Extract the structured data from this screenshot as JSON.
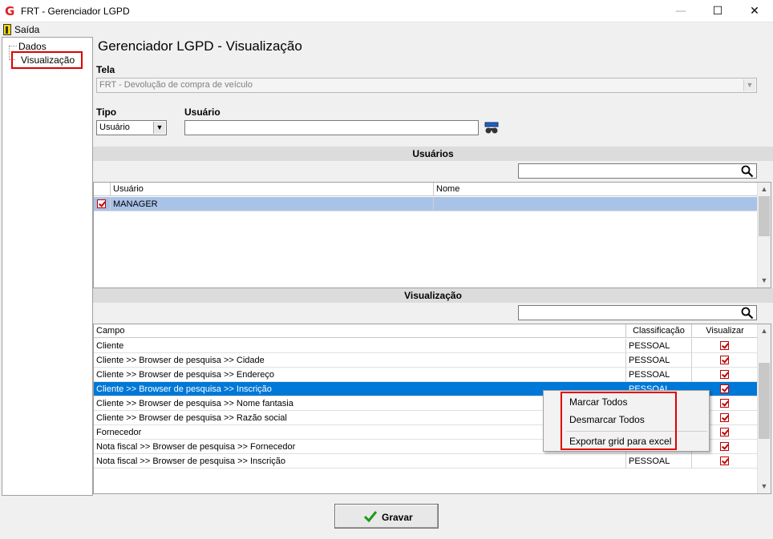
{
  "window": {
    "title": "FRT - Gerenciador LGPD",
    "app_icon": "G",
    "controls": {
      "minimize": "—",
      "maximize": "☐",
      "close": "✕"
    }
  },
  "menu": {
    "exit_label": "Saída"
  },
  "tree": {
    "items": [
      {
        "label": "Dados"
      },
      {
        "label": "Visualização",
        "selected": true
      }
    ]
  },
  "main": {
    "title": "Gerenciador LGPD - Visualização",
    "tela": {
      "label": "Tela",
      "value": "FRT - Devolução de compra de veículo"
    },
    "tipo": {
      "label": "Tipo",
      "value": "Usuário"
    },
    "usuario": {
      "label": "Usuário",
      "value": ""
    }
  },
  "usuarios_section": {
    "title": "Usuários",
    "columns": [
      "Usuário",
      "Nome"
    ],
    "rows": [
      {
        "usuario": "MANAGER",
        "nome": "",
        "checked": true
      }
    ]
  },
  "visualizacao_section": {
    "title": "Visualização",
    "columns": [
      "Campo",
      "Classificação",
      "Visualizar"
    ],
    "rows": [
      {
        "campo": "Cliente",
        "classificacao": "PESSOAL",
        "visualizar": true
      },
      {
        "campo": "Cliente >> Browser de pesquisa >> Cidade",
        "classificacao": "PESSOAL",
        "visualizar": true
      },
      {
        "campo": "Cliente >> Browser de pesquisa >> Endereço",
        "classificacao": "PESSOAL",
        "visualizar": true
      },
      {
        "campo": "Cliente >> Browser de pesquisa >> Inscrição",
        "classificacao": "PESSOAL",
        "visualizar": true,
        "selected": true
      },
      {
        "campo": "Cliente >> Browser de pesquisa >> Nome fantasia",
        "classificacao": "",
        "visualizar": true
      },
      {
        "campo": "Cliente >> Browser de pesquisa >> Razão social",
        "classificacao": "",
        "visualizar": true
      },
      {
        "campo": "Fornecedor",
        "classificacao": "",
        "visualizar": true
      },
      {
        "campo": "Nota fiscal >> Browser de pesquisa >> Fornecedor",
        "classificacao": "",
        "visualizar": true
      },
      {
        "campo": "Nota fiscal >> Browser de pesquisa >> Inscrição",
        "classificacao": "PESSOAL",
        "visualizar": true
      }
    ]
  },
  "context_menu": {
    "items": [
      "Marcar Todos",
      "Desmarcar Todos",
      "Exportar grid para excel"
    ]
  },
  "footer": {
    "save_button": "Gravar"
  },
  "colors": {
    "selection": "#0078d7",
    "selected_row_users": "#a9c3e8",
    "highlight_border": "#e00000",
    "check": "#c00000"
  }
}
